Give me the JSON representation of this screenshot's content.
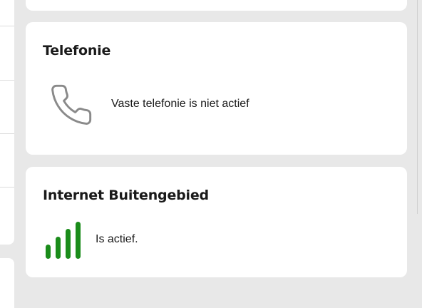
{
  "telefonie": {
    "title": "Telefonie",
    "status": "Vaste telefonie is niet actief",
    "icon": "phone-icon",
    "icon_color": "#8a8a8a"
  },
  "internet": {
    "title": "Internet Buitengebied",
    "status": "Is actief.",
    "icon": "signal-bars-icon",
    "signal_color": "#1a8c1a",
    "signal_level": 1.0
  }
}
